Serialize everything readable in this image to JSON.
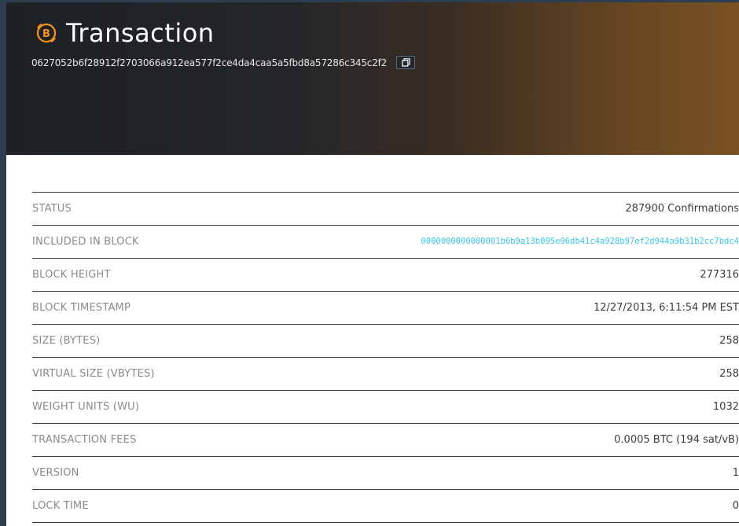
{
  "header": {
    "title": "Transaction",
    "hash": "0627052b6f28912f2703066a912ea577f2ce4da4caa5a5fbd8a57286c345c2f2",
    "icon": "bitcoin-icon",
    "copy_icon": "copy-icon"
  },
  "colors": {
    "accent": "#f7931a",
    "link": "#39c6e6"
  },
  "details": {
    "rows": [
      {
        "label": "STATUS",
        "value": "287900 Confirmations"
      },
      {
        "label": "INCLUDED IN BLOCK",
        "value": "0000000000000001b6b9a13b095e96db41c4a928b97ef2d944a9b31b2cc7bdc4"
      },
      {
        "label": "BLOCK HEIGHT",
        "value": "277316"
      },
      {
        "label": "BLOCK TIMESTAMP",
        "value": "12/27/2013, 6:11:54 PM EST"
      },
      {
        "label": "SIZE (BYTES)",
        "value": "258"
      },
      {
        "label": "VIRTUAL SIZE (VBYTES)",
        "value": "258"
      },
      {
        "label": "WEIGHT UNITS (WU)",
        "value": "1032"
      },
      {
        "label": "TRANSACTION FEES",
        "value": "0.0005 BTC (194 sat/vB)"
      },
      {
        "label": "VERSION",
        "value": "1"
      },
      {
        "label": "LOCK TIME",
        "value": "0"
      }
    ]
  }
}
